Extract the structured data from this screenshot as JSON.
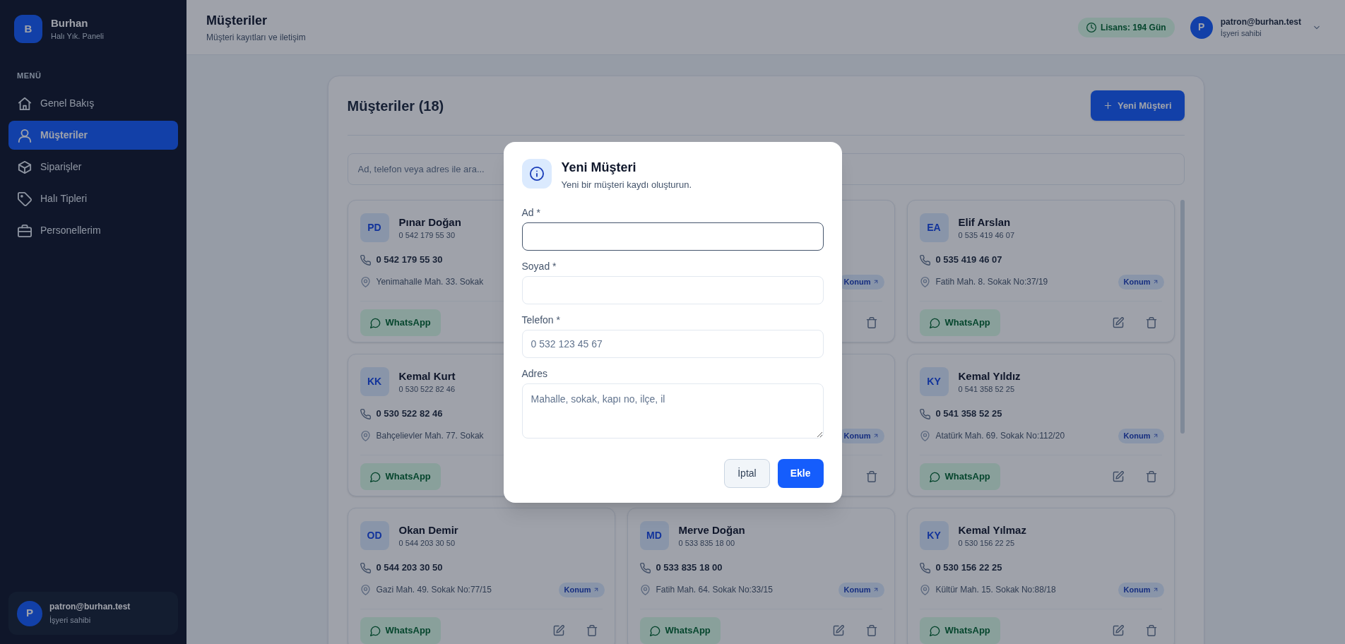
{
  "sidebar": {
    "logo": "B",
    "brand": "Burhan",
    "tagline": "Halı Yık. Paneli",
    "section": "MENÜ",
    "items": [
      {
        "label": "Genel Bakış",
        "selected": false
      },
      {
        "label": "Müşteriler",
        "selected": true
      },
      {
        "label": "Siparişler",
        "selected": false
      },
      {
        "label": "Halı Tipleri",
        "selected": false
      },
      {
        "label": "Personellerim",
        "selected": false
      }
    ],
    "user": {
      "avatar": "P",
      "email": "patron@burhan.test",
      "role": "İşyeri sahibi"
    }
  },
  "header": {
    "title": "Müşteriler",
    "subtitle": "Müşteri kayıtları ve iletişim",
    "license": "Lisans: 194 Gün",
    "user": {
      "avatar": "P",
      "email": "patron@burhan.test",
      "role": "İşyeri sahibi"
    }
  },
  "panel": {
    "title": "Müşteriler (18)",
    "new_button": "Yeni Müşteri",
    "search": {
      "placeholder": "Ad, telefon veya adres ile ara..."
    },
    "customers": [
      {
        "initials": "PD",
        "name": "Pınar Doğan",
        "subtitle": "0 542 179 55 30",
        "phone": "0 542 179 55 30",
        "address": "Yenimahalle Mah. 33. Sokak",
        "whatsapp": "WhatsApp"
      },
      {
        "badge": "Konum",
        "actions": [
          {
            "kind": "delete"
          }
        ]
      },
      {
        "initials": "EA",
        "name": "Elif Arslan",
        "subtitle": "0 535 419 46 07",
        "phone": "0 535 419 46 07",
        "address": "Fatih Mah. 8. Sokak No:37/19",
        "badge": "Konum",
        "whatsapp": "WhatsApp",
        "actions": [
          {
            "kind": "edit"
          },
          {
            "kind": "delete"
          }
        ]
      },
      {
        "initials": "KK",
        "name": "Kemal Kurt",
        "subtitle": "0 530 522 82 46",
        "phone": "0 530 522 82 46",
        "address": "Bahçelievler Mah. 77. Sokak",
        "whatsapp": "WhatsApp"
      },
      {
        "badge": "Konum",
        "actions": [
          {
            "kind": "delete"
          }
        ]
      },
      {
        "initials": "KY",
        "name": "Kemal Yıldız",
        "subtitle": "0 541 358 52 25",
        "phone": "0 541 358 52 25",
        "address": "Atatürk Mah. 69. Sokak No:112/20",
        "badge": "Konum",
        "whatsapp": "WhatsApp",
        "actions": [
          {
            "kind": "edit"
          },
          {
            "kind": "delete"
          }
        ]
      },
      {
        "initials": "OD",
        "name": "Okan Demir",
        "subtitle": "0 544 203 30 50",
        "phone": "0 544 203 30 50",
        "address": "Gazi Mah. 49. Sokak No:77/15",
        "badge": "Konum",
        "whatsapp": "WhatsApp",
        "actions": [
          {
            "kind": "edit"
          },
          {
            "kind": "delete"
          }
        ]
      },
      {
        "initials": "MD",
        "name": "Merve Doğan",
        "subtitle": "0 533 835 18 00",
        "phone": "0 533 835 18 00",
        "address": "Fatih Mah. 64. Sokak No:33/15",
        "badge": "Konum",
        "whatsapp": "WhatsApp",
        "actions": [
          {
            "kind": "edit"
          },
          {
            "kind": "delete"
          }
        ]
      },
      {
        "initials": "KY",
        "name": "Kemal Yılmaz",
        "subtitle": "0 530 156 22 25",
        "phone": "0 530 156 22 25",
        "address": "Kültür Mah. 15. Sokak No:88/18",
        "badge": "Konum",
        "whatsapp": "WhatsApp",
        "actions": [
          {
            "kind": "edit"
          },
          {
            "kind": "delete"
          }
        ]
      }
    ]
  },
  "dialog": {
    "title": "Yeni Müşteri",
    "subtitle": "Yeni bir müşteri kaydı oluşturun.",
    "fields": [
      {
        "label": "Ad *",
        "kind": "input",
        "focused": true
      },
      {
        "label": "Soyad *",
        "kind": "input",
        "focused": false
      },
      {
        "label": "Telefon *",
        "kind": "input",
        "placeholder": "0 532 123 45 67",
        "focused": false
      },
      {
        "label": "Adres",
        "kind": "textarea",
        "placeholder": "Mahalle, sokak, kapı no, ilçe, il",
        "focused": false
      }
    ],
    "buttons": [
      {
        "label": "İptal",
        "kind": "secondary"
      },
      {
        "label": "Ekle",
        "kind": "primary"
      }
    ]
  }
}
